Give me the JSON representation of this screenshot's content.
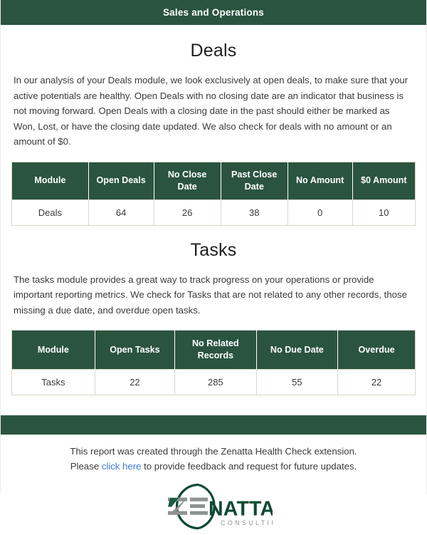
{
  "banner": {
    "title": "Sales and Operations"
  },
  "sections": [
    {
      "heading": "Deals",
      "paragraph": "In our analysis of your Deals module, we look exclusively at open deals, to make sure that your active potentials are healthy. Open Deals with no closing date are an indicator that business is not moving forward. Open Deals with a closing date in the past should either be marked as Won, Lost, or have the closing date updated. We also check for deals with no amount or an amount of $0.",
      "table": {
        "columns": [
          "Module",
          "Open Deals",
          "No Close Date",
          "Past Close Date",
          "No Amount",
          "$0 Amount"
        ],
        "rows": [
          [
            "Deals",
            "64",
            "26",
            "38",
            "0",
            "10"
          ]
        ]
      }
    },
    {
      "heading": "Tasks",
      "paragraph": "The tasks module provides a great way to track progress on your operations or provide important reporting metrics. We check for Tasks that are not related to any other records, those missing a due date, and overdue open tasks.",
      "table": {
        "columns": [
          "Module",
          "Open Tasks",
          "No Related Records",
          "No Due Date",
          "Overdue"
        ],
        "rows": [
          [
            "Tasks",
            "22",
            "285",
            "55",
            "22"
          ]
        ]
      }
    }
  ],
  "footer": {
    "line1": "This report was created through the Zenatta Health Check extension.",
    "line2_before": "Please ",
    "link_text": "click here",
    "line2_after": " to provide feedback and request for future updates.",
    "logo": {
      "name": "zenatta-consulting-logo",
      "word_part1": "ZE",
      "word_part2": "NATTA",
      "tagline": "CONSULTING"
    }
  },
  "colors": {
    "brand_green": "#2a5440",
    "logo_green": "#0d4a31",
    "logo_gray": "#8e9290",
    "link_blue": "#3c78d8",
    "table_border": "#ddd7c7"
  }
}
